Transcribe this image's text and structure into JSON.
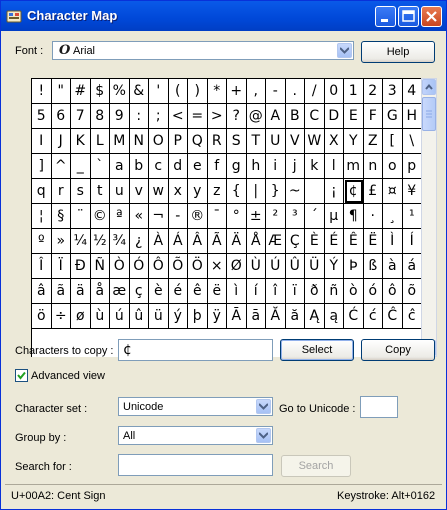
{
  "window": {
    "title": "Character Map"
  },
  "font": {
    "label": "Font :",
    "value": "Arial",
    "help_label": "Help"
  },
  "grid": {
    "rows": [
      [
        "!",
        "\"",
        "#",
        "$",
        "%",
        "&",
        "'",
        "(",
        ")",
        "*",
        "+",
        ",",
        "-",
        ".",
        "/",
        "0",
        "1",
        "2",
        "3",
        "4"
      ],
      [
        "5",
        "6",
        "7",
        "8",
        "9",
        ":",
        ";",
        "<",
        "=",
        ">",
        "?",
        "@",
        "A",
        "B",
        "C",
        "D",
        "E",
        "F",
        "G",
        "H"
      ],
      [
        "I",
        "J",
        "K",
        "L",
        "M",
        "N",
        "O",
        "P",
        "Q",
        "R",
        "S",
        "T",
        "U",
        "V",
        "W",
        "X",
        "Y",
        "Z",
        "[",
        "\\"
      ],
      [
        "]",
        "^",
        "_",
        "`",
        "a",
        "b",
        "c",
        "d",
        "e",
        "f",
        "g",
        "h",
        "i",
        "j",
        "k",
        "l",
        "m",
        "n",
        "o",
        "p"
      ],
      [
        "q",
        "r",
        "s",
        "t",
        "u",
        "v",
        "w",
        "x",
        "y",
        "z",
        "{",
        "|",
        "}",
        "~",
        " ",
        "¡",
        "¢",
        "£",
        "¤",
        "¥"
      ],
      [
        "¦",
        "§",
        "¨",
        "©",
        "ª",
        "«",
        "¬",
        "-",
        "®",
        "¯",
        "°",
        "±",
        "²",
        "³",
        "´",
        "µ",
        "¶",
        "·",
        "¸",
        "¹"
      ],
      [
        "º",
        "»",
        "¼",
        "½",
        "¾",
        "¿",
        "À",
        "Á",
        "Â",
        "Ã",
        "Ä",
        "Å",
        "Æ",
        "Ç",
        "È",
        "É",
        "Ê",
        "Ë",
        "Ì",
        "Í"
      ],
      [
        "Î",
        "Ï",
        "Ð",
        "Ñ",
        "Ò",
        "Ó",
        "Ô",
        "Õ",
        "Ö",
        "×",
        "Ø",
        "Ù",
        "Ú",
        "Û",
        "Ü",
        "Ý",
        "Þ",
        "ß",
        "à",
        "á"
      ],
      [
        "â",
        "ã",
        "ä",
        "å",
        "æ",
        "ç",
        "è",
        "é",
        "ê",
        "ë",
        "ì",
        "í",
        "î",
        "ï",
        "ð",
        "ñ",
        "ò",
        "ó",
        "ô",
        "õ"
      ],
      [
        "ö",
        "÷",
        "ø",
        "ù",
        "ú",
        "û",
        "ü",
        "ý",
        "þ",
        "ÿ",
        "Ā",
        "ā",
        "Ă",
        "ă",
        "Ą",
        "ą",
        "Ć",
        "ć",
        "Ĉ",
        "ĉ"
      ]
    ],
    "selected": {
      "row": 4,
      "col": 16
    }
  },
  "copy": {
    "label": "Characters to copy :",
    "value": "¢",
    "select_label": "Select",
    "copy_label": "Copy"
  },
  "advanced": {
    "label": "Advanced view",
    "checked": true
  },
  "charset": {
    "label": "Character set :",
    "value": "Unicode",
    "goto_label": "Go to Unicode :",
    "goto_value": ""
  },
  "groupby": {
    "label": "Group by :",
    "value": "All"
  },
  "search": {
    "label": "Search for :",
    "value": "",
    "button_label": "Search"
  },
  "status": {
    "char_info": "U+00A2: Cent Sign",
    "keystroke": "Keystroke: Alt+0162"
  }
}
